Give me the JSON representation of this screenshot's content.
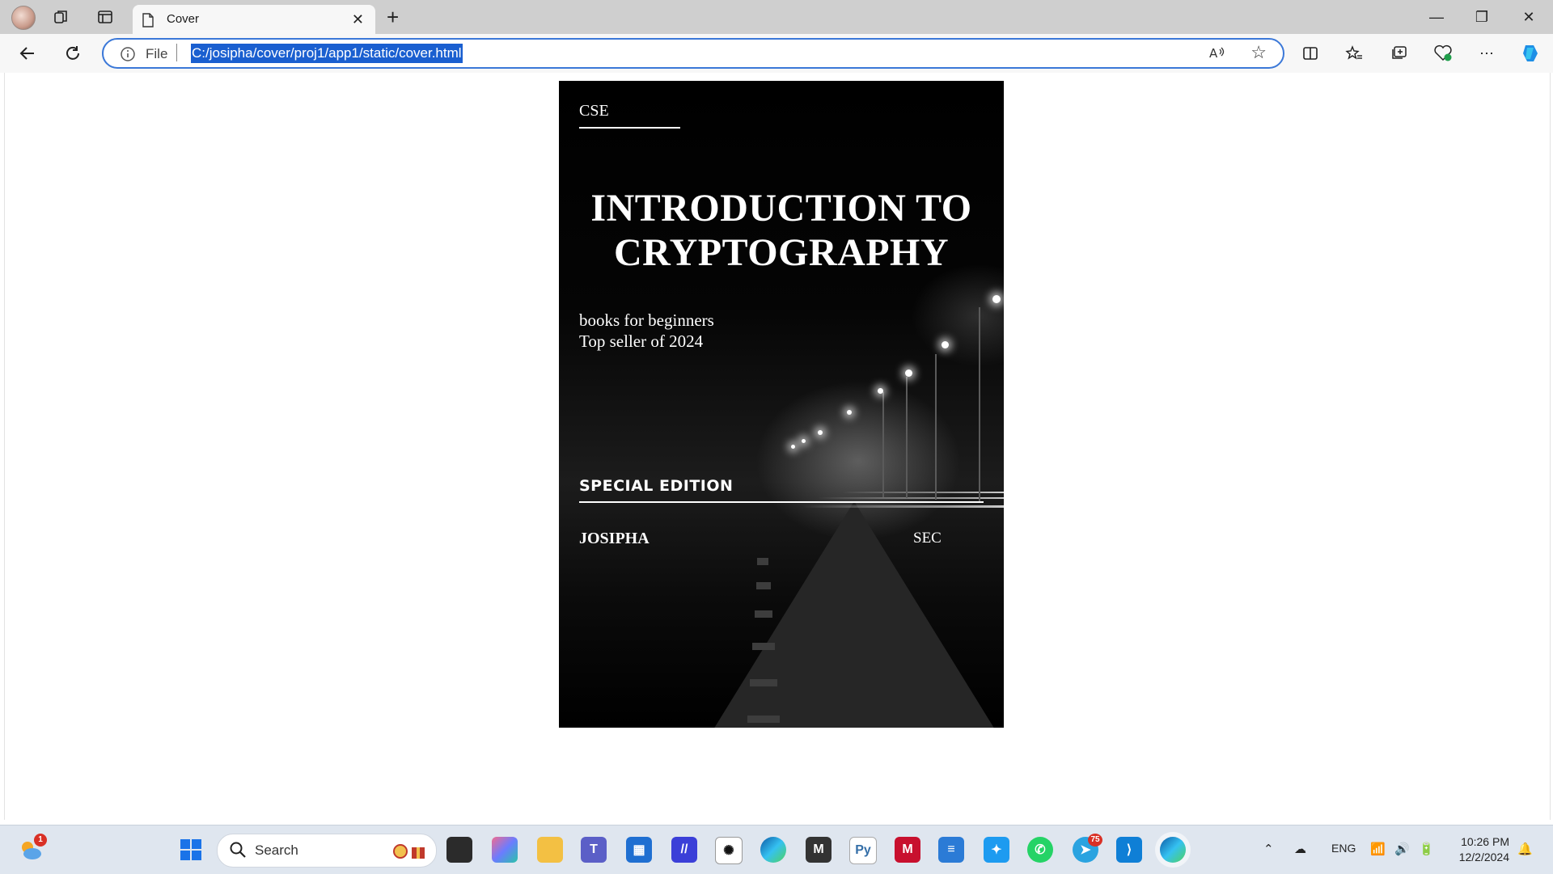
{
  "browser": {
    "tab_title": "Cover",
    "tab_close": "✕",
    "new_tab": "+",
    "address_scheme": "File",
    "url": "C:/josipha/cover/proj1/app1/static/cover.html"
  },
  "window_controls": {
    "minimize": "—",
    "restore": "❐",
    "close": "✕"
  },
  "cover": {
    "tag": "CSE",
    "title_line1": "INTRODUCTION TO",
    "title_line2": "CRYPTOGRAPHY",
    "subtitle_line1": "books for beginners",
    "subtitle_line2": "Top seller of 2024",
    "edition": "SPECIAL EDITION",
    "author": "JOSIPHA",
    "section": "SEC"
  },
  "taskbar": {
    "search_label": "Search",
    "weather_badge": "1",
    "telegram_badge": "75",
    "language": "ENG",
    "time": "10:26 PM",
    "date": "12/2/2024"
  }
}
